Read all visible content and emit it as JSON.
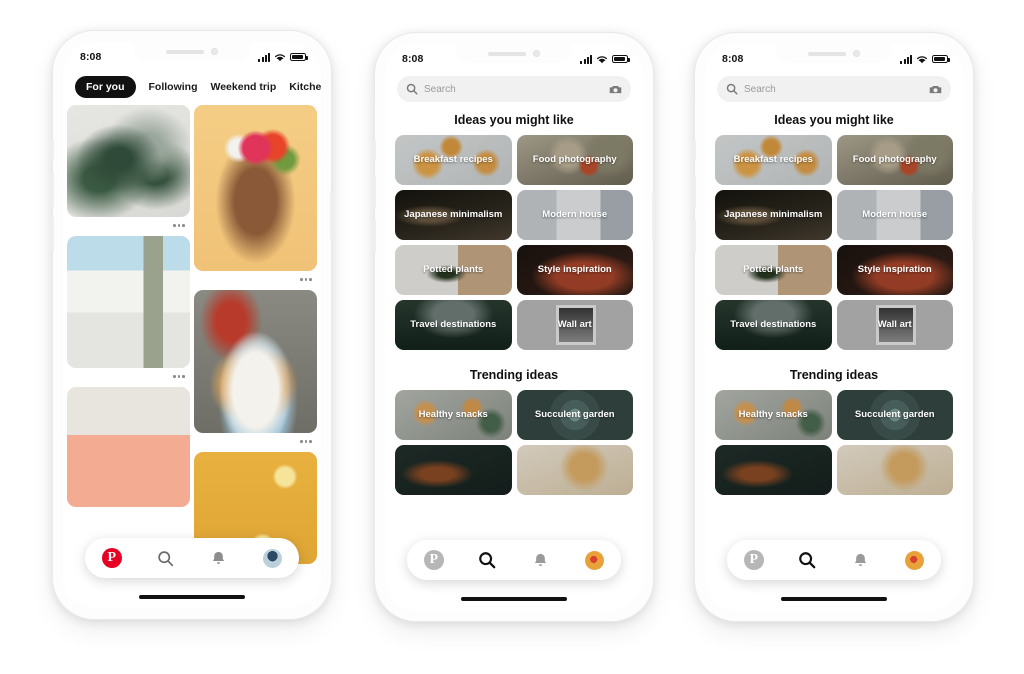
{
  "status_bar": {
    "time": "8:08",
    "signal_icon": "signal-bars-icon",
    "wifi_icon": "wifi-icon",
    "battery_icon": "battery-icon"
  },
  "phone1": {
    "tabs": [
      {
        "label": "For you",
        "active": true
      },
      {
        "label": "Following",
        "active": false
      },
      {
        "label": "Weekend trip",
        "active": false
      },
      {
        "label": "Kitche",
        "active": false
      }
    ],
    "pins": [
      {
        "name": "rubber-plant-pin"
      },
      {
        "name": "woman-flower-crown-pin"
      },
      {
        "name": "white-house-pin"
      },
      {
        "name": "tacos-plate-pin"
      },
      {
        "name": "sand-dune-pin"
      },
      {
        "name": "lemon-yellow-pin"
      }
    ],
    "nav": {
      "home_label": "Home",
      "search_label": "Search",
      "notifications_label": "Notifications",
      "profile_label": "Profile",
      "active": "home"
    }
  },
  "phone2": {
    "search": {
      "placeholder": "Search",
      "value": "",
      "camera_icon": "camera-icon",
      "search_icon": "search-icon"
    },
    "sections": [
      {
        "title": "Ideas you might like",
        "tiles": [
          {
            "label": "Breakfast recipes",
            "art": "ph-breakfast"
          },
          {
            "label": "Food photography",
            "art": "ph-figs"
          },
          {
            "label": "Japanese minimalism",
            "art": "ph-japan"
          },
          {
            "label": "Modern house",
            "art": "ph-modern"
          },
          {
            "label": "Potted plants",
            "art": "ph-potted"
          },
          {
            "label": "Style inspiration",
            "art": "ph-style"
          },
          {
            "label": "Travel destinations",
            "art": "ph-travel"
          },
          {
            "label": "Wall art",
            "art": "ph-wallart"
          }
        ]
      },
      {
        "title": "Trending ideas",
        "tiles": [
          {
            "label": "Healthy snacks",
            "art": "ph-snacks"
          },
          {
            "label": "Succulent garden",
            "art": "ph-succulent"
          },
          {
            "label": "",
            "art": "ph-darkfood"
          },
          {
            "label": "",
            "art": "ph-pastry"
          }
        ]
      }
    ],
    "nav": {
      "home_label": "Home",
      "search_label": "Search",
      "notifications_label": "Notifications",
      "profile_label": "Profile",
      "active": "search"
    }
  },
  "phone3": {
    "search": {
      "placeholder": "Search",
      "value": "",
      "camera_icon": "camera-icon",
      "search_icon": "search-icon"
    },
    "sections": [
      {
        "title": "Ideas you might like",
        "tiles": [
          {
            "label": "Breakfast recipes",
            "art": "ph-breakfast"
          },
          {
            "label": "Food photography",
            "art": "ph-figs"
          },
          {
            "label": "Japanese minimalism",
            "art": "ph-japan"
          },
          {
            "label": "Modern house",
            "art": "ph-modern"
          },
          {
            "label": "Potted plants",
            "art": "ph-potted"
          },
          {
            "label": "Style inspiration",
            "art": "ph-style"
          },
          {
            "label": "Travel destinations",
            "art": "ph-travel"
          },
          {
            "label": "Wall art",
            "art": "ph-wallart"
          }
        ]
      },
      {
        "title": "Trending ideas",
        "tiles": [
          {
            "label": "Healthy snacks",
            "art": "ph-snacks"
          },
          {
            "label": "Succulent garden",
            "art": "ph-succulent"
          },
          {
            "label": "",
            "art": "ph-darkfood"
          },
          {
            "label": "",
            "art": "ph-pastry"
          }
        ]
      }
    ],
    "nav": {
      "home_label": "Home",
      "search_label": "Search",
      "notifications_label": "Notifications",
      "profile_label": "Profile",
      "active": "search"
    }
  },
  "colors": {
    "pinterest_red": "#E60023",
    "pinterest_gray": "#999999",
    "active_tab_bg": "#111111",
    "search_bar_bg": "#F1F1F1",
    "page_bg": "#FFFFFF",
    "phone_frame": "#FDFDFD"
  }
}
